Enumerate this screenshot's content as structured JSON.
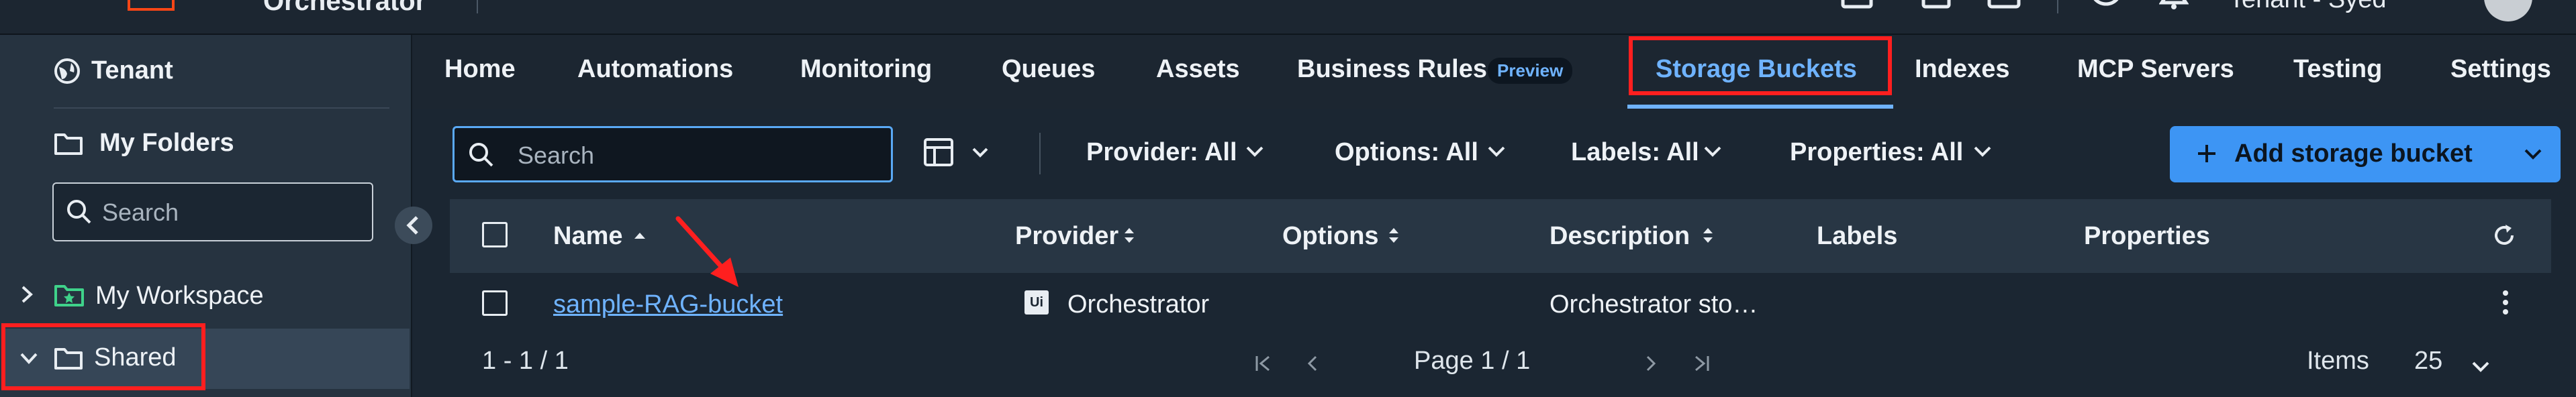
{
  "topbar": {
    "product": "Orchestrator",
    "tenant_label": "Tenant - Syed"
  },
  "sidebar": {
    "tenant": "Tenant",
    "my_folders": "My Folders",
    "search_placeholder": "Search",
    "items": [
      {
        "label": "My Workspace"
      },
      {
        "label": "Shared"
      }
    ]
  },
  "tabs": [
    {
      "label": "Home"
    },
    {
      "label": "Automations"
    },
    {
      "label": "Monitoring"
    },
    {
      "label": "Queues"
    },
    {
      "label": "Assets"
    },
    {
      "label": "Business Rules",
      "badge": "Preview"
    },
    {
      "label": "Storage Buckets",
      "active": true
    },
    {
      "label": "Indexes"
    },
    {
      "label": "MCP Servers"
    },
    {
      "label": "Testing"
    },
    {
      "label": "Settings"
    }
  ],
  "toolbar": {
    "search_placeholder": "Search",
    "filters": {
      "provider": "Provider: All",
      "options": "Options: All",
      "labels": "Labels: All",
      "properties": "Properties: All"
    },
    "add_button": "Add storage bucket"
  },
  "table": {
    "columns": [
      "Name",
      "Provider",
      "Options",
      "Description",
      "Labels",
      "Properties"
    ],
    "rows": [
      {
        "name": "sample-RAG-bucket",
        "provider_icon": "Ui",
        "provider": "Orchestrator",
        "options": "",
        "description": "Orchestrator sto…",
        "labels": "",
        "properties": ""
      }
    ]
  },
  "pagination": {
    "range": "1 - 1 / 1",
    "page": "Page 1 / 1",
    "items_label": "Items",
    "page_size": "25"
  },
  "colors": {
    "accent": "#3d95f4",
    "link": "#6fb3ff",
    "highlight": "#ff1f1f",
    "background": "#1b2632"
  }
}
